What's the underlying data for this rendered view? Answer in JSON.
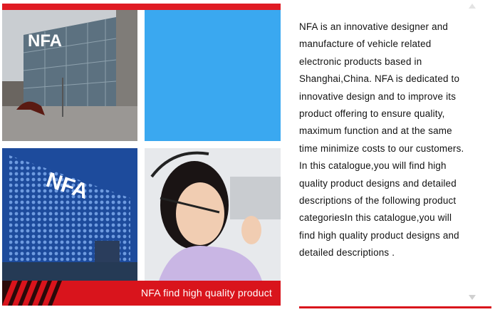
{
  "gallery": {
    "building1_logo": "NFA",
    "building2_logo": "NFA",
    "caption": "NFA find high quality product"
  },
  "description": {
    "text": "NFA is an innovative designer and manufacture of vehicle related electronic products based in Shanghai,China. NFA is dedicated to innovative design and to improve its product offering to ensure quality, maximum function and at the same time minimize costs to our customers. In this catalogue,you will find high quality product designs and detailed descriptions of the following product categoriesIn this catalogue,you will find high quality product designs and detailed descriptions ."
  },
  "colors": {
    "accent_red": "#d9141c",
    "tile_blue": "#3aa8f0"
  },
  "icons": {
    "scroll_up": "triangle-up-icon",
    "scroll_down": "triangle-down-icon"
  }
}
